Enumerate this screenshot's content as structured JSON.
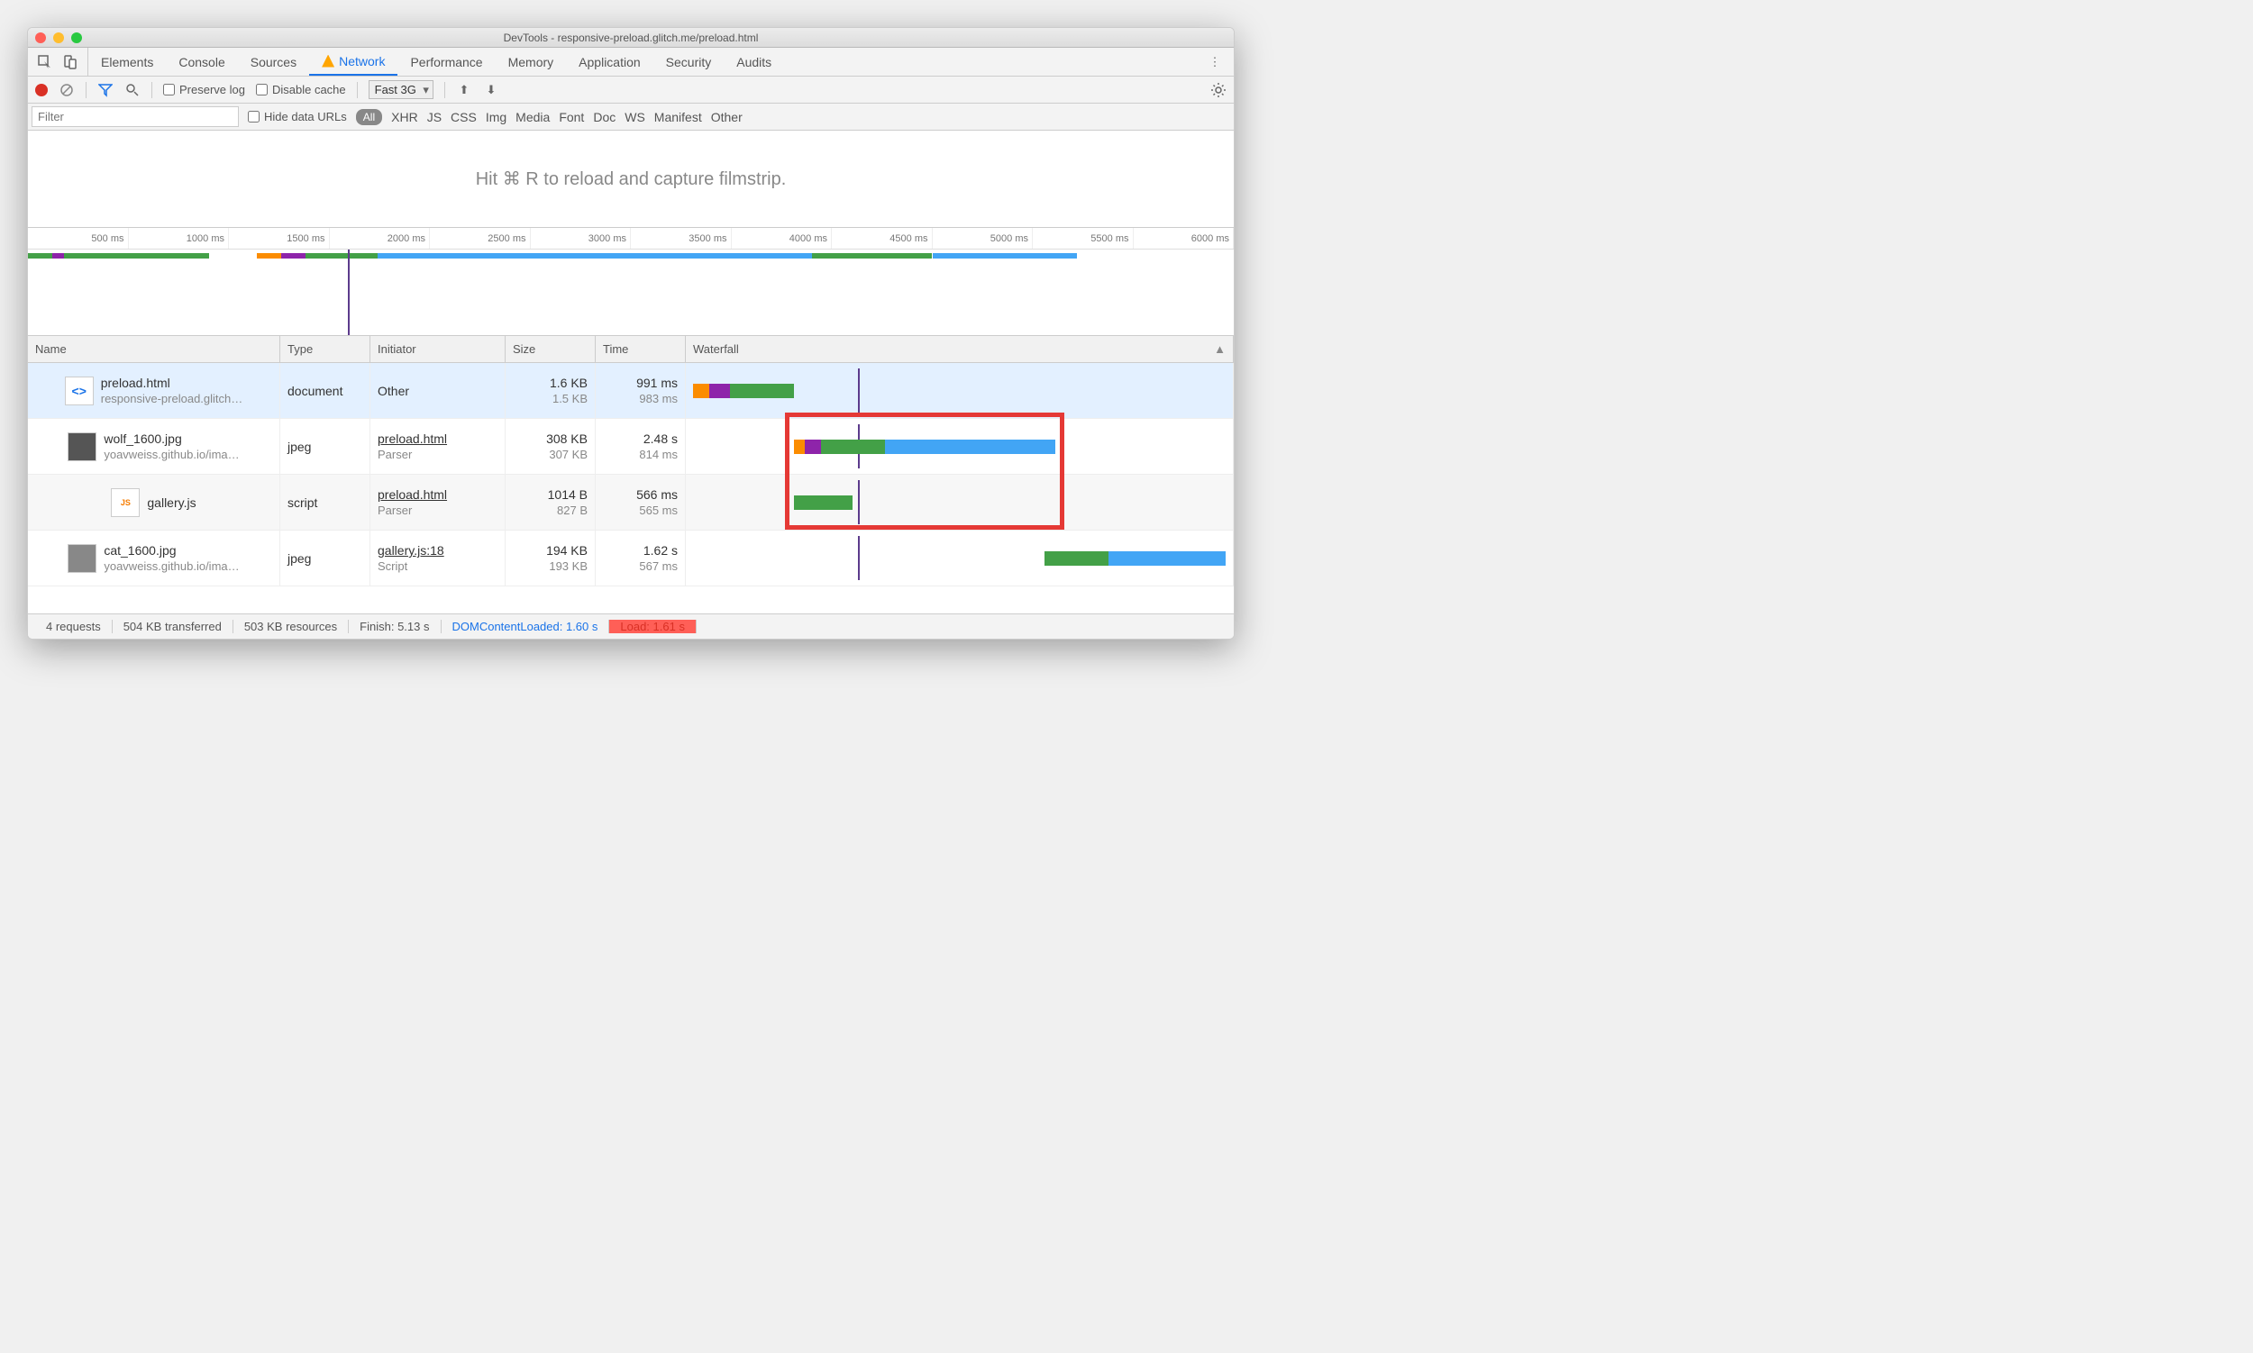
{
  "window_title": "DevTools - responsive-preload.glitch.me/preload.html",
  "tabs": [
    "Elements",
    "Console",
    "Sources",
    "Network",
    "Performance",
    "Memory",
    "Application",
    "Security",
    "Audits"
  ],
  "active_tab": "Network",
  "toolbar": {
    "preserve_log": "Preserve log",
    "disable_cache": "Disable cache",
    "throttle": "Fast 3G"
  },
  "filterbar": {
    "filter_placeholder": "Filter",
    "hide_data_urls": "Hide data URLs",
    "types": [
      "All",
      "XHR",
      "JS",
      "CSS",
      "Img",
      "Media",
      "Font",
      "Doc",
      "WS",
      "Manifest",
      "Other"
    ]
  },
  "filmstrip_hint": "Hit ⌘ R to reload and capture filmstrip.",
  "overview_ticks": [
    "500 ms",
    "1000 ms",
    "1500 ms",
    "2000 ms",
    "2500 ms",
    "3000 ms",
    "3500 ms",
    "4000 ms",
    "4500 ms",
    "5000 ms",
    "5500 ms",
    "6000 ms"
  ],
  "columns": {
    "name": "Name",
    "type": "Type",
    "initiator": "Initiator",
    "size": "Size",
    "time": "Time",
    "waterfall": "Waterfall"
  },
  "rows": [
    {
      "name": "preload.html",
      "sub": "responsive-preload.glitch…",
      "type": "document",
      "initiator": "Other",
      "initiator_sub": "",
      "size": "1.6 KB",
      "size_sub": "1.5 KB",
      "time": "991 ms",
      "time_sub": "983 ms",
      "icon": "html"
    },
    {
      "name": "wolf_1600.jpg",
      "sub": "yoavweiss.github.io/ima…",
      "type": "jpeg",
      "initiator": "preload.html",
      "initiator_sub": "Parser",
      "size": "308 KB",
      "size_sub": "307 KB",
      "time": "2.48 s",
      "time_sub": "814 ms",
      "icon": "img"
    },
    {
      "name": "gallery.js",
      "sub": "",
      "type": "script",
      "initiator": "preload.html",
      "initiator_sub": "Parser",
      "size": "1014 B",
      "size_sub": "827 B",
      "time": "566 ms",
      "time_sub": "565 ms",
      "icon": "js"
    },
    {
      "name": "cat_1600.jpg",
      "sub": "yoavweiss.github.io/ima…",
      "type": "jpeg",
      "initiator": "gallery.js:18",
      "initiator_sub": "Script",
      "size": "194 KB",
      "size_sub": "193 KB",
      "time": "1.62 s",
      "time_sub": "567 ms",
      "icon": "img"
    }
  ],
  "footer": {
    "requests": "4 requests",
    "transferred": "504 KB transferred",
    "resources": "503 KB resources",
    "finish": "Finish: 5.13 s",
    "dcl": "DOMContentLoaded: 1.60 s",
    "load": "Load: 1.61 s"
  }
}
